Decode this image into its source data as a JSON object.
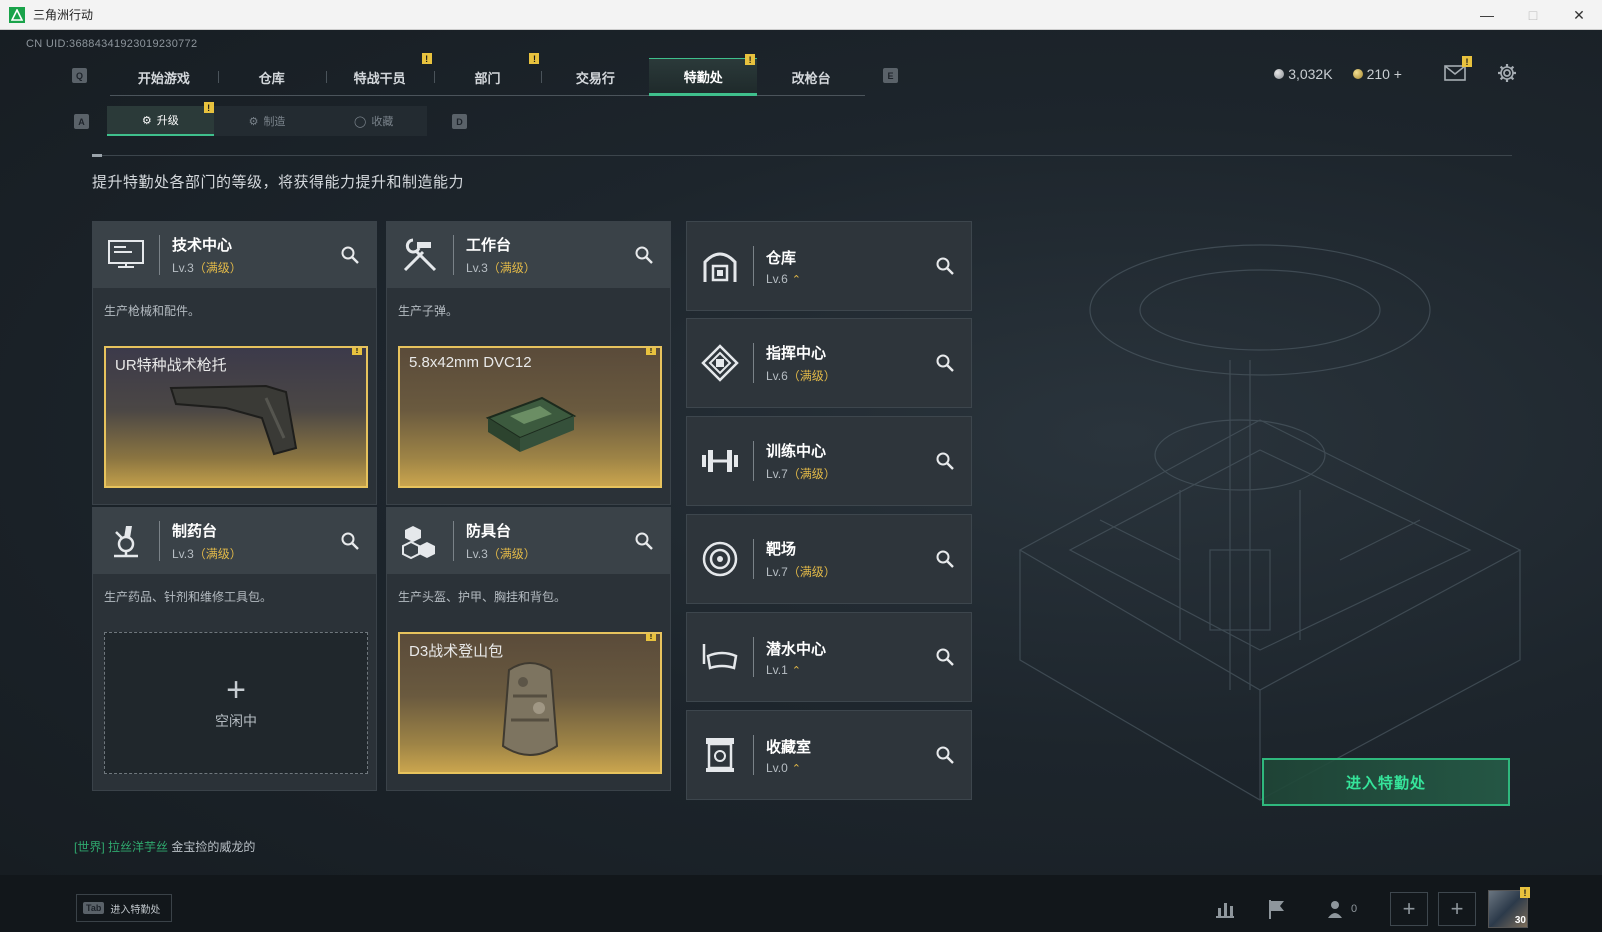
{
  "window": {
    "title": "三角洲行动"
  },
  "uid": "CN UID:3688434192301923077​2",
  "keys": {
    "left_nav": "Q",
    "right_nav": "E",
    "left_sub": "A",
    "right_sub": "D"
  },
  "nav": {
    "tabs": [
      {
        "label": "开始游戏",
        "badge": ""
      },
      {
        "label": "仓库",
        "badge": ""
      },
      {
        "label": "特战干员",
        "badge": "!"
      },
      {
        "label": "部门",
        "badge": "!"
      },
      {
        "label": "交易行",
        "badge": ""
      },
      {
        "label": "特勤处",
        "badge": "!"
      },
      {
        "label": "改枪台",
        "badge": ""
      }
    ],
    "active": "特勤处"
  },
  "currency": {
    "silver": "3,032K",
    "gold": "210 +"
  },
  "subnav": {
    "tabs": [
      {
        "label": "升级",
        "badge": "!"
      },
      {
        "label": "制造",
        "badge": ""
      },
      {
        "label": "收藏",
        "badge": ""
      }
    ]
  },
  "description": "提升特勤处各部门的等级，将获得能力提升和制造能力",
  "workshops": [
    {
      "name": "技术中心",
      "level": "Lv.3",
      "status": "（满级）",
      "desc": "生产枪械和配件。",
      "slot": "UR特种战术枪托",
      "slot_badge": "!"
    },
    {
      "name": "工作台",
      "level": "Lv.3",
      "status": "（满级）",
      "desc": "生产子弹。",
      "slot": "5.8x42mm DVC12",
      "slot_badge": "!"
    },
    {
      "name": "制药台",
      "level": "Lv.3",
      "status": "（满级）",
      "desc": "生产药品、针剂和维修工具包。",
      "slot_empty": "空闲中"
    },
    {
      "name": "防具台",
      "level": "Lv.3",
      "status": "（满级）",
      "desc": "生产头盔、护甲、胸挂和背包。",
      "slot": "D3战术登山包",
      "slot_badge": "!"
    }
  ],
  "buildings": [
    {
      "name": "仓库",
      "level": "Lv.6",
      "status": ""
    },
    {
      "name": "指挥中心",
      "level": "Lv.6",
      "status": "（满级）"
    },
    {
      "name": "训练中心",
      "level": "Lv.7",
      "status": "（满级）"
    },
    {
      "name": "靶场",
      "level": "Lv.7",
      "status": "（满级）"
    },
    {
      "name": "潜水中心",
      "level": "Lv.1",
      "status": ""
    },
    {
      "name": "收藏室",
      "level": "Lv.0",
      "status": ""
    }
  ],
  "enter_button": "进入特勤处",
  "chat": {
    "channel": "[世界]",
    "user": "拉丝洋芋丝",
    "message": "金宝捡的威龙的"
  },
  "bottom": {
    "tab_key": "Tab",
    "tab_label": "进入特勤处",
    "friends_count": "0",
    "avatar_level": "30"
  },
  "colors": {
    "accent": "#3fbf8c",
    "gold": "#e2b948",
    "badge": "#e8c23e"
  }
}
